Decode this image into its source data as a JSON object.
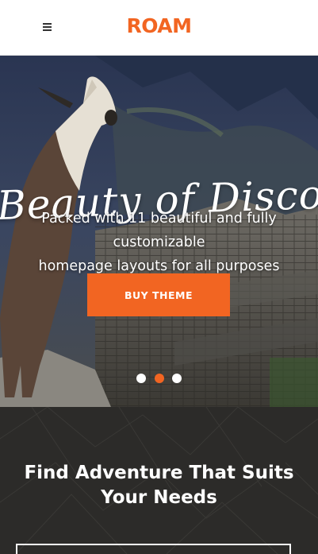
{
  "header": {
    "logo": "ROAM",
    "menu_icon": "hamburger-menu-icon"
  },
  "hero": {
    "title": "Beauty of Discovery",
    "subtitle_line1": "Packed with 11 beautiful and fully customizable",
    "subtitle_line2": "homepage layouts for all purposes",
    "button_label": "BUY THEME",
    "slides": 3,
    "active_slide": 2
  },
  "section": {
    "title_line1": "Find Adventure That Suits",
    "title_line2": "Your Needs"
  },
  "colors": {
    "accent": "#f26522",
    "dark_bg": "#2c2b29",
    "header_bg": "#ffffff"
  }
}
